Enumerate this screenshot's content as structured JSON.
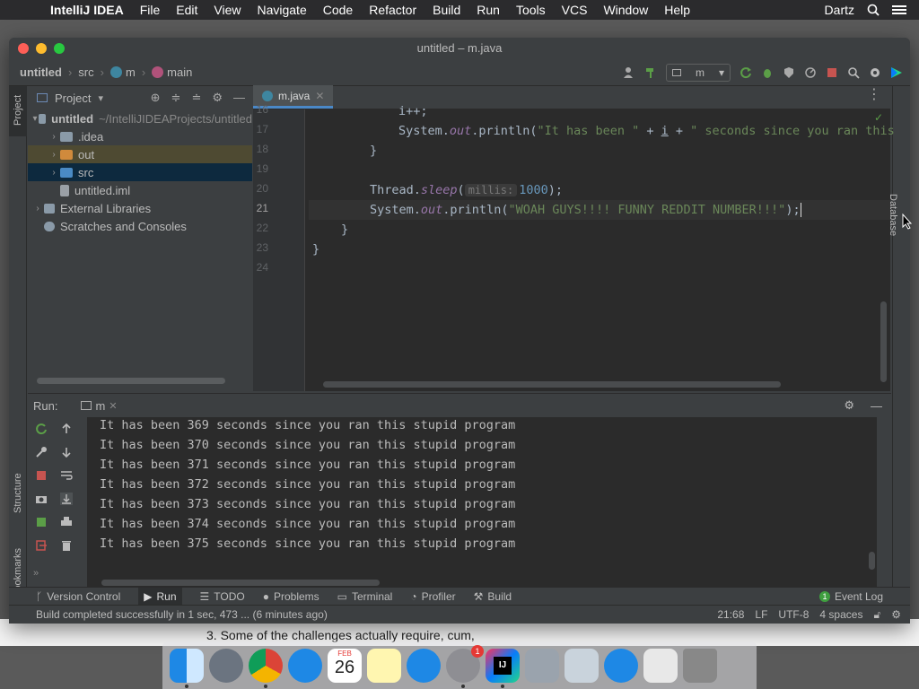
{
  "menubar": {
    "app": "IntelliJ IDEA",
    "items": [
      "File",
      "Edit",
      "View",
      "Navigate",
      "Code",
      "Refactor",
      "Build",
      "Run",
      "Tools",
      "VCS",
      "Window",
      "Help"
    ],
    "user": "Dartz"
  },
  "window": {
    "title": "untitled – m.java"
  },
  "breadcrumb": {
    "project": "untitled",
    "folder": "src",
    "class": "m",
    "method": "main"
  },
  "toolbar": {
    "run_config": "m"
  },
  "project_panel": {
    "title": "Project",
    "root_name": "untitled",
    "root_path": "~/IntelliJIDEAProjects/untitled",
    "items": [
      {
        "label": ".idea"
      },
      {
        "label": "out"
      },
      {
        "label": "src"
      },
      {
        "label": "untitled.iml"
      }
    ],
    "external": "External Libraries",
    "scratches": "Scratches and Consoles"
  },
  "editor": {
    "tab": "m.java",
    "line_numbers": [
      "16",
      "17",
      "18",
      "19",
      "20",
      "21",
      "22",
      "23",
      "24"
    ],
    "code": {
      "l16": "i++;",
      "l17_a": "System.",
      "l17_out": "out",
      "l17_b": ".println(",
      "l17_str1": "\"It has been \"",
      "l17_c": " + ",
      "l17_i": "i",
      "l17_d": " + ",
      "l17_str2": "\" seconds since you ran this",
      "l18": "}",
      "l20_a": "Thread.",
      "l20_sleep": "sleep",
      "l20_b": "(",
      "l20_hint": "millis:",
      "l20_num": "1000",
      "l20_c": ");",
      "l21_a": "System.",
      "l21_out": "out",
      "l21_b": ".println(",
      "l21_str": "\"WOAH GUYS!!!! FUNNY REDDIT NUMBER!!!\"",
      "l21_c": ");",
      "l22": "}",
      "l23": "}"
    }
  },
  "run_panel": {
    "label": "Run:",
    "tab": "m",
    "output": [
      "It has been 369 seconds since you ran this stupid program",
      "It has been 370 seconds since you ran this stupid program",
      "It has been 371 seconds since you ran this stupid program",
      "It has been 372 seconds since you ran this stupid program",
      "It has been 373 seconds since you ran this stupid program",
      "It has been 374 seconds since you ran this stupid program",
      "It has been 375 seconds since you ran this stupid program"
    ]
  },
  "side_stripes": {
    "left_top": "Project",
    "left_structure": "Structure",
    "left_bookmarks": "Bookmarks",
    "right": "Database"
  },
  "bottom_bar": {
    "items": [
      "Version Control",
      "Run",
      "TODO",
      "Problems",
      "Terminal",
      "Profiler",
      "Build"
    ],
    "event_log": "Event Log"
  },
  "status_bar": {
    "message": "Build completed successfully in 1 sec, 473 ... (6 minutes ago)",
    "position": "21:68",
    "line_sep": "LF",
    "encoding": "UTF-8",
    "indent": "4 spaces"
  },
  "background_doc": {
    "text": "3. Some of the challenges actually require, cum,"
  },
  "dock": {
    "calendar_month": "FEB",
    "calendar_day": "26",
    "badge": "1",
    "ij_label": "IJ"
  }
}
